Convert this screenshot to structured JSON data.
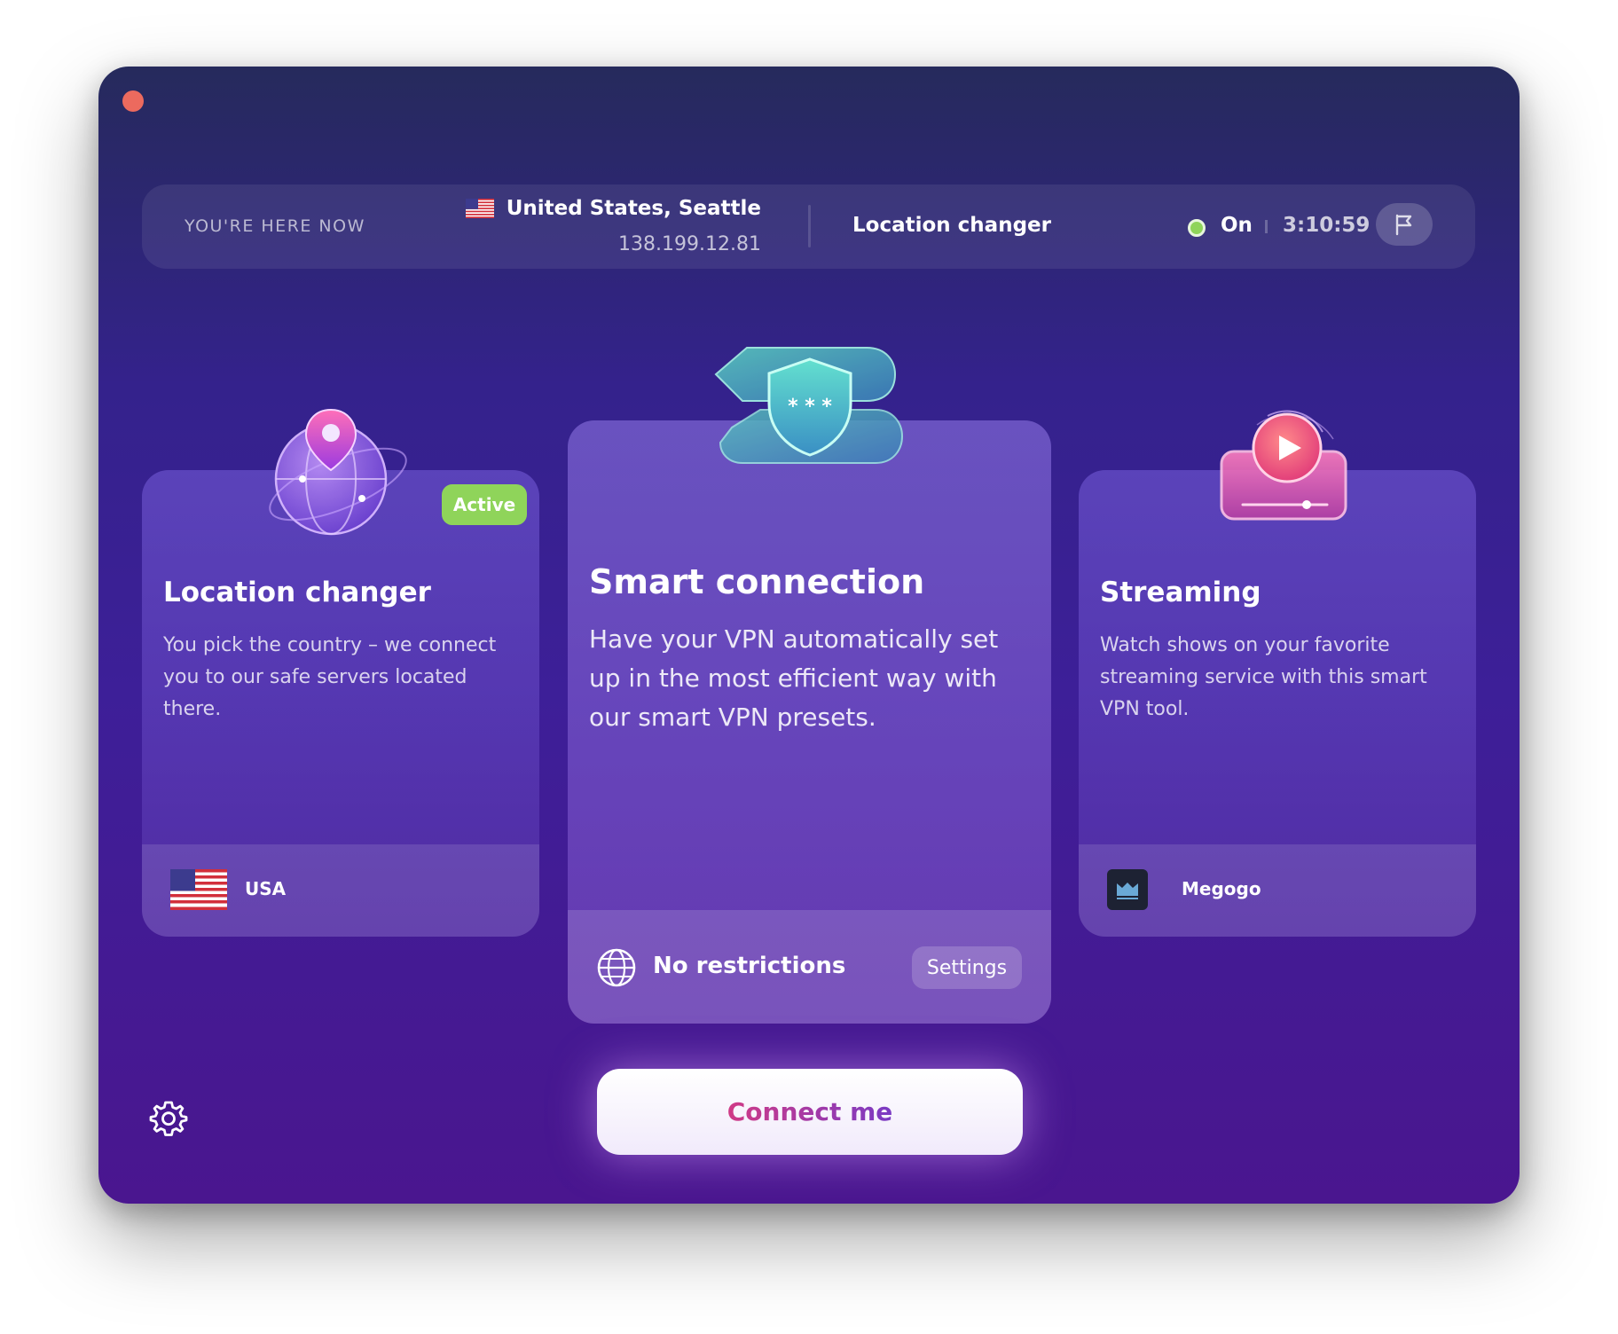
{
  "window": {
    "controls": {
      "close_color": "#ec6a5e"
    }
  },
  "topbar": {
    "here_label": "YOU'RE HERE NOW",
    "location": "United States, Seattle",
    "ip": "138.199.12.81",
    "mode": "Location changer",
    "status": "On",
    "timer": "3:10:59",
    "status_color": "#8fd45a"
  },
  "cards": {
    "location": {
      "badge": "Active",
      "title": "Location changer",
      "description": "You pick the country – we connect you to our safe servers located there.",
      "footer_label": "USA",
      "footer_icon": "usa-flag-icon"
    },
    "smart": {
      "title": "Smart connection",
      "description": "Have your VPN automatically set up in the most efficient way with our smart VPN presets.",
      "footer_label": "No restrictions",
      "footer_icon": "globe-icon",
      "settings_label": "Settings"
    },
    "streaming": {
      "title": "Streaming",
      "description": "Watch shows on your favorite streaming service with this smart VPN tool.",
      "footer_label": "Megogo",
      "footer_icon": "megogo-logo"
    }
  },
  "actions": {
    "connect_label": "Connect me",
    "settings_icon": "gear-icon"
  },
  "colors": {
    "active_badge": "#8fd45a",
    "connect_text": "#c03489"
  }
}
